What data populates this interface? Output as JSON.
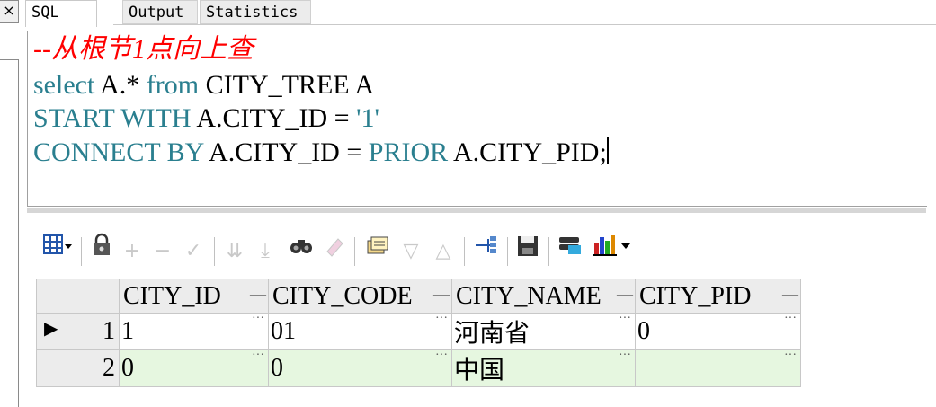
{
  "tabs": [
    {
      "label": "SQL"
    },
    {
      "label": "Output"
    },
    {
      "label": "Statistics"
    }
  ],
  "close_glyph": "×",
  "editor": {
    "comment": "--从根节1点向上查",
    "line1": {
      "kw1": "select",
      "mid": " A.* ",
      "kw2": "from",
      "rest": " CITY_TREE A"
    },
    "line2": {
      "kw": "START WITH",
      "rest": " A.CITY_ID = ",
      "str": "'1'"
    },
    "line3": {
      "kw": "CONNECT BY",
      "rest": " A.CITY_ID = ",
      "kw2": "PRIOR",
      "rest2": " A.CITY_PID;"
    }
  },
  "toolbar_icons": [
    "grid-options-icon",
    "lock-icon",
    "add-record-icon",
    "delete-record-icon",
    "post-changes-icon",
    "next-page-icon",
    "last-page-icon",
    "find-icon",
    "clear-icon",
    "query-by-example-icon",
    "sort-desc-icon",
    "sort-asc-icon",
    "link-icon",
    "save-icon",
    "export-icon",
    "chart-icon"
  ],
  "grid": {
    "columns": [
      "CITY_ID",
      "CITY_CODE",
      "CITY_NAME",
      "CITY_PID"
    ],
    "rows": [
      {
        "num": "1",
        "cells": [
          "1",
          "01",
          "河南省",
          "0"
        ]
      },
      {
        "num": "2",
        "cells": [
          "0",
          "0",
          "中国",
          ""
        ]
      }
    ],
    "cell_button": "···",
    "current_row_marker": "▶"
  },
  "colors": {
    "keyword": "#2a7f8f",
    "comment": "#ff0000",
    "alt_row": "#e6f7e0"
  }
}
